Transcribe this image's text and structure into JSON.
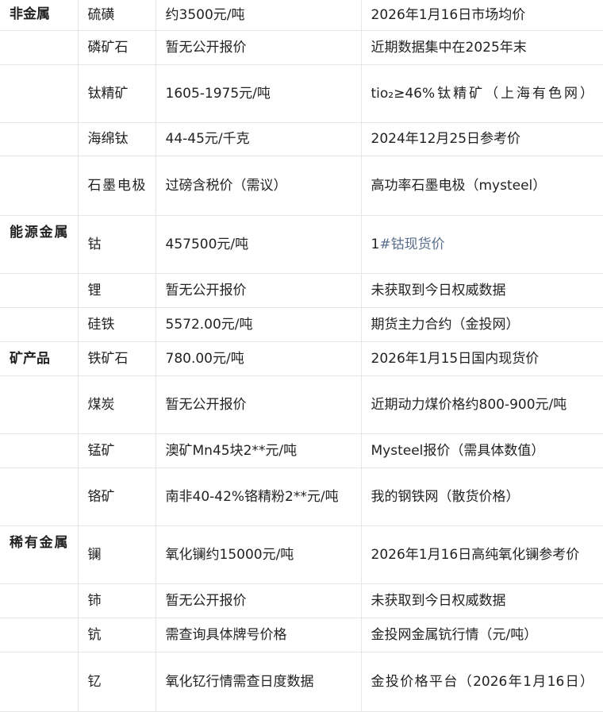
{
  "rows": [
    {
      "category": "非金属",
      "name": "硫磺",
      "price": "约3500元/吨",
      "source": "2026年1月16日市场均价"
    },
    {
      "category": "",
      "name": "磷矿石",
      "price": "暂无公开报价",
      "source": "近期数据集中在2025年末"
    },
    {
      "category": "",
      "name": "钛精矿",
      "price": "1605-1975元/吨",
      "source": "tio₂≥46%钛精矿（上海有色网）"
    },
    {
      "category": "",
      "name": "海绵钛",
      "price": "44-45元/千克",
      "source": "2024年12月25日参考价"
    },
    {
      "category": "",
      "name": "石墨电极",
      "price": "过磅含税价（需议）",
      "source": "高功率石墨电极（mysteel）"
    },
    {
      "category": "能源金属",
      "name": "钴",
      "price": "457500元/吨",
      "source_prefix": "1",
      "source_link": "#钴现货价"
    },
    {
      "category": "",
      "name": "锂",
      "price": "暂无公开报价",
      "source": "未获取到今日权威数据"
    },
    {
      "category": "",
      "name": "硅铁",
      "price": "5572.00元/吨",
      "source": "期货主力合约（金投网）"
    },
    {
      "category": "矿产品",
      "name": "铁矿石",
      "price": "780.00元/吨",
      "source": "2026年1月15日国内现货价"
    },
    {
      "category": "",
      "name": "煤炭",
      "price": "暂无公开报价",
      "source": "近期动力煤价格约800-900元/吨"
    },
    {
      "category": "",
      "name": "锰矿",
      "price": "澳矿Mn45块2**元/吨",
      "source": "Mysteel报价（需具体数值）"
    },
    {
      "category": "",
      "name": "铬矿",
      "price": "南非40-42%铬精粉2**元/吨",
      "source": "我的钢铁网（散货价格）"
    },
    {
      "category": "稀有金属",
      "name": "镧",
      "price": "氧化镧约15000元/吨",
      "source": "2026年1月16日高纯氧化镧参考价"
    },
    {
      "category": "",
      "name": "铈",
      "price": "暂无公开报价",
      "source": "未获取到今日权威数据"
    },
    {
      "category": "",
      "name": "钪",
      "price": "需查询具体牌号价格",
      "source": "金投网金属钪行情（元/吨）"
    },
    {
      "category": "",
      "name": "钇",
      "price": "氧化钇行情需查日度数据",
      "source": "金投价格平台（2026年1月16日）"
    }
  ]
}
